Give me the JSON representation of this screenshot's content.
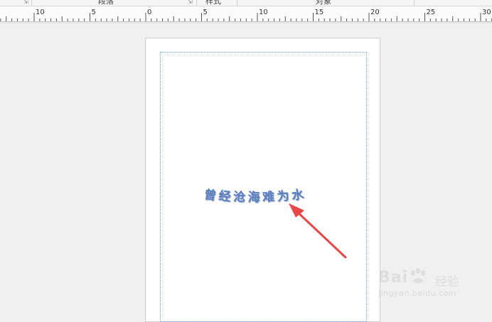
{
  "ribbon": {
    "groups": [
      {
        "label": "段落"
      },
      {
        "label": "样式"
      },
      {
        "label": "对象"
      }
    ]
  },
  "ruler": {
    "labels": [
      "10",
      "5",
      "0",
      "5",
      "10",
      "15",
      "20",
      "25",
      "30"
    ]
  },
  "document": {
    "wordart_text": "曾经沧海难为水",
    "wordart_color": "#5a7fc0",
    "annotation_arrow_color": "#e84848"
  },
  "watermark": {
    "logo": "Bai",
    "cn": "经验",
    "url": "jingyan.baidu.com"
  }
}
